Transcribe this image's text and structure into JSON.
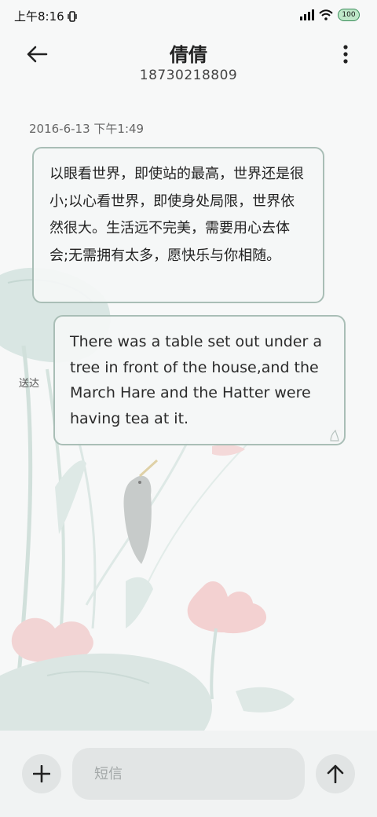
{
  "status_bar": {
    "time": "上午8:16",
    "battery": "100"
  },
  "header": {
    "contact_name": "倩倩",
    "contact_number": "18730218809"
  },
  "conversation": {
    "timestamp": "2016-6-13 下午1:49",
    "messages": [
      {
        "direction": "received",
        "text": "以眼看世界，即使站的最高，世界还是很小;以心看世界，即使身处局限，世界依然很大。生活远不完美，需要用心去体会;无需拥有太多，愿快乐与你相随。"
      },
      {
        "direction": "sent",
        "text": "There was a table set out under a tree in front of the house,and the March Hare and the Hatter were having tea at it.",
        "status": "送达"
      }
    ]
  },
  "composer": {
    "placeholder": "短信"
  },
  "icons": {
    "back": "arrow-left-icon",
    "more": "more-vertical-icon",
    "add": "plus-icon",
    "send": "arrow-up-icon"
  },
  "colors": {
    "bubble_border": "#a9beb6",
    "bubble_fill": "#f4f6f6",
    "battery": "#bfe8c9"
  }
}
